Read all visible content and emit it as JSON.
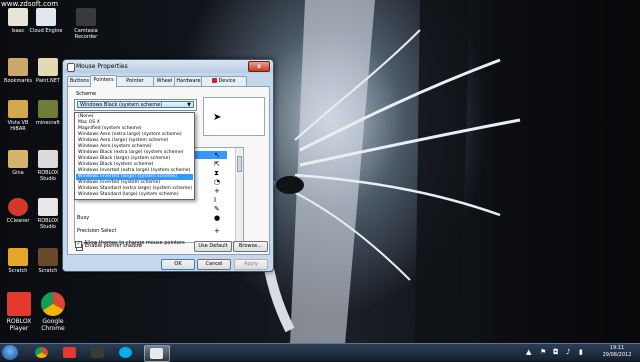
{
  "watermark": "www.zdsoft.com",
  "desktop": {
    "icons": [
      {
        "label": "Isaac",
        "color": "#e9e4d8"
      },
      {
        "label": "Cloud Engine",
        "color": "#dfe8f0"
      },
      {
        "label": "Camtasia Recorder",
        "color": "#3a3a3a"
      },
      {
        "label": "Bookmarks",
        "color": "#c9a86a"
      },
      {
        "label": "Paint.NET",
        "color": "#e3d9b5"
      },
      {
        "label": "Vista VB HiBAR",
        "color": "#d2a94a"
      },
      {
        "label": "minecraft",
        "color": "#6f7d3a"
      },
      {
        "label": "Gina",
        "color": "#d6b46b"
      },
      {
        "label": "ROBLOX Studio",
        "color": "#dcdcdc"
      },
      {
        "label": "CCleaner",
        "color": "#d2382c"
      },
      {
        "label": "ROBLOX Studio",
        "color": "#e8e8e8"
      },
      {
        "label": "Scratch",
        "color": "#e6a52b"
      },
      {
        "label": "Scratch",
        "color": "#6a4a2a"
      }
    ],
    "roblox_player": {
      "label_line1": "ROBLOX",
      "label_line2": "Player",
      "color": "#e23b2e"
    },
    "chrome": {
      "label_line1": "Google",
      "label_line2": "Chrome"
    }
  },
  "window": {
    "title": "Mouse Properties",
    "close_label": "x",
    "tabs": [
      "Buttons",
      "Pointers",
      "Pointer Options",
      "Wheel",
      "Hardware",
      "Device Settings"
    ],
    "active_tab": "Pointers",
    "scheme_label": "Scheme",
    "scheme_value": "Windows Black (system scheme)",
    "customize_label": "Cu",
    "cursor_rows": [
      {
        "label": "",
        "glyph": "↖"
      },
      {
        "label": "",
        "glyph": "⇱"
      },
      {
        "label": "",
        "glyph": "⧗"
      },
      {
        "label": "",
        "glyph": "◔"
      },
      {
        "label": "",
        "glyph": "+"
      },
      {
        "label": "",
        "glyph": "I"
      },
      {
        "label": "",
        "glyph": "✎"
      },
      {
        "label": "Busy",
        "glyph": "●"
      },
      {
        "label": "Precision Select",
        "glyph": "+"
      }
    ],
    "dropdown_items": [
      "(None)",
      "Mac OS X",
      "Magnified (system scheme)",
      "Windows Aero (extra large) (system scheme)",
      "Windows Aero (large) (system scheme)",
      "Windows Aero (system scheme)",
      "Windows Black (extra large) (system scheme)",
      "Windows Black (large) (system scheme)",
      "Windows Black (system scheme)",
      "Windows Inverted (extra large) (system scheme)",
      "Windows Inverted (large) (system scheme)",
      "Windows Inverted (system scheme)",
      "Windows Standard (extra large) (system scheme)",
      "Windows Standard (large) (system scheme)"
    ],
    "dropdown_selected_index": 10,
    "enable_shadow": "Enable pointer shadow",
    "allow_themes": "Allow themes to change mouse pointers",
    "use_default": "Use Default",
    "browse": "Browse...",
    "ok": "OK",
    "cancel": "Cancel",
    "apply": "Apply"
  },
  "taskbar": {
    "time": "19:11",
    "date": "29/08/2012"
  }
}
